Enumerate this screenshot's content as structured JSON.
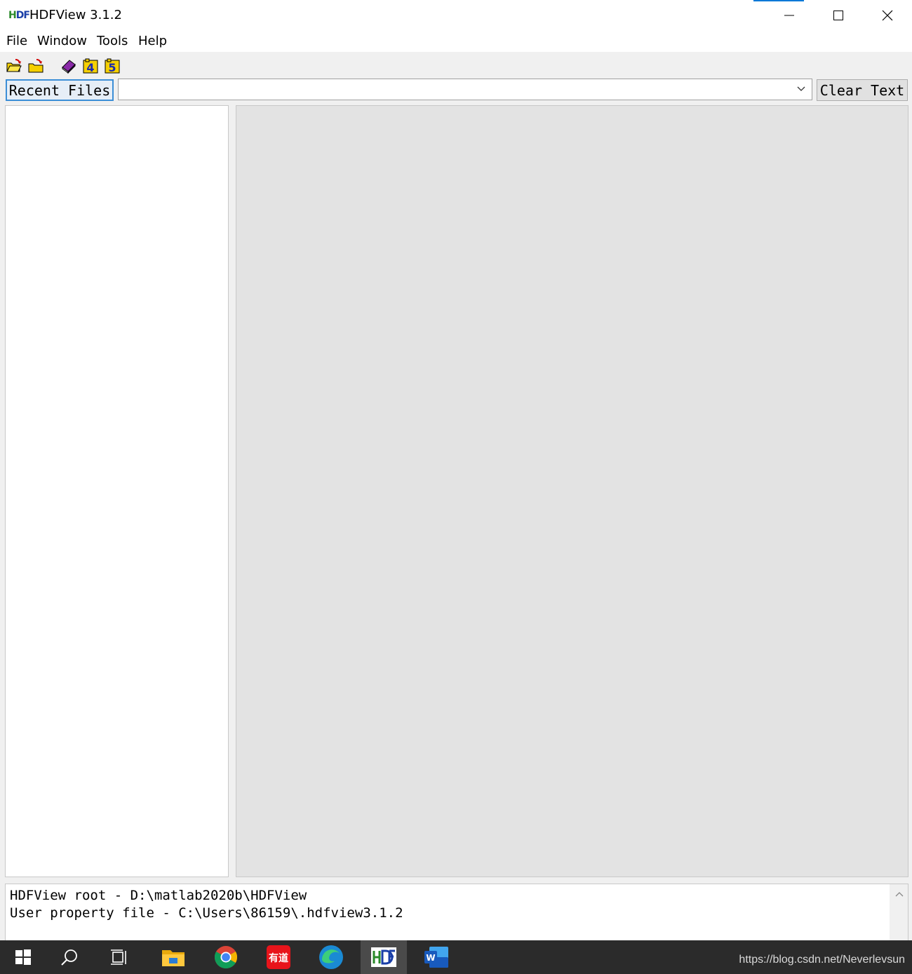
{
  "window": {
    "title": "HDFView 3.1.2",
    "logo_text": "HDF"
  },
  "menu": {
    "items": [
      "File",
      "Window",
      "Tools",
      "Help"
    ]
  },
  "toolbar": {
    "icons": [
      "open-folder-icon",
      "open-readonly-folder-icon",
      "users-guide-book-icon",
      "hdf4-library-icon",
      "hdf5-library-icon"
    ],
    "hdf4_label": "4",
    "hdf5_label": "5"
  },
  "recent": {
    "button_label": "Recent Files",
    "combo_value": "",
    "clear_label": "Clear Text"
  },
  "log": {
    "lines": [
      "HDFView root - D:\\matlab2020b\\HDFView",
      "User property file - C:\\Users\\86159\\.hdfview3.1.2"
    ]
  },
  "taskbar": {
    "apps": [
      "windows-start-icon",
      "search-icon",
      "task-view-icon",
      "file-explorer-icon",
      "chrome-icon",
      "youdao-icon",
      "edge-icon",
      "hdfview-icon",
      "word-icon"
    ],
    "youdao_label": "有道",
    "word_label": "W",
    "watermark": "https://blog.csdn.net/Neverlevsun"
  },
  "colors": {
    "accent": "#0078d7",
    "content_bg": "#e3e3e3",
    "taskbar_bg": "#2b2b2b"
  }
}
